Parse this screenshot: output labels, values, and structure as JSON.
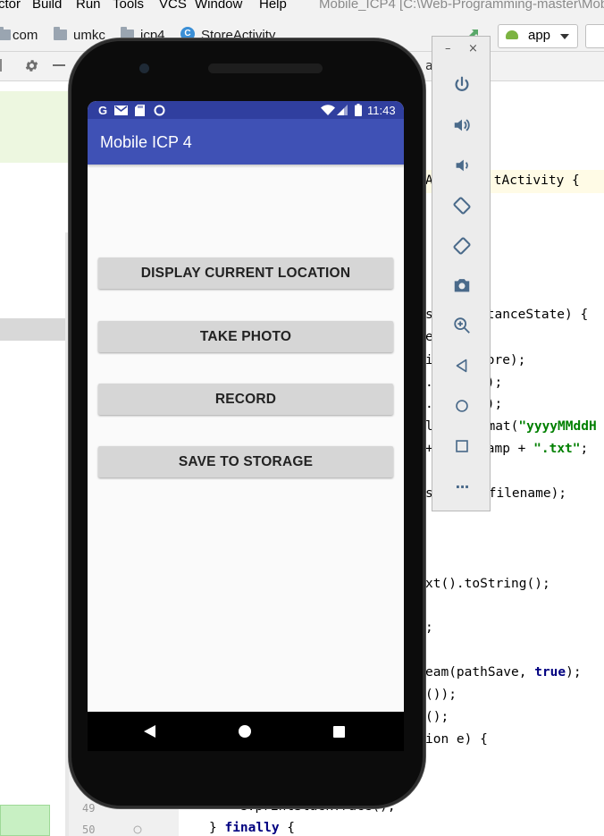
{
  "ide": {
    "menu": [
      "ctor",
      "Build",
      "Run",
      "Tools",
      "VCS",
      "Window",
      "Help"
    ],
    "window_title": "Mobile_ICP4 [C:\\Web-Programming-master\\Mob",
    "breadcrumbs": [
      "com",
      "umkc",
      "icp4",
      "StoreActivity"
    ],
    "class_icon_letter": "C",
    "run_config": "app",
    "tab_fragment": "a",
    "line_numbers": [
      "49",
      "50"
    ],
    "code_lines": {
      "l1": "AppCompatActivity {",
      "l1a": "A",
      "l1b": "tActivity {",
      "l2a": "s",
      "l2b": "tanceState) {",
      "l3": "e",
      "l4a": "i",
      "l4b": "ore);",
      "l5a": ".",
      "l5b": ");",
      "l6a": ".",
      "l6b": ");",
      "l7a": "l",
      "l7b": "rmat(",
      "l7c": "\"yyyyMMddH",
      "l8a": "+",
      "l8b": "amp + ",
      "l8c": "\".txt\"",
      "l8d": ";",
      "l9a": "s",
      "l9b": "filename);",
      "l10": "xt().toString();",
      "l11": ";",
      "l12a": "eam(pathSave, ",
      "l12b": "true",
      "l12c": ");",
      "l13": "());",
      "l14": "();",
      "l15": "ion e) {",
      "l16": "e.printStackTrace();",
      "l17a": "} ",
      "l17b": "finally",
      "l17c": " {"
    }
  },
  "emulator": {
    "minimize": "–",
    "close": "×",
    "buttons": [
      "power-icon",
      "volume-up-icon",
      "volume-down-icon",
      "rotate-left-icon",
      "rotate-right-icon",
      "camera-icon",
      "zoom-icon",
      "back-icon",
      "home-icon",
      "overview-icon",
      "more-icon"
    ],
    "more_label": "···"
  },
  "phone": {
    "status_time": "11:43",
    "status_icons": [
      "google-icon",
      "gmail-icon",
      "sd-card-icon",
      "sync-icon",
      "wifi-icon",
      "signal-icon",
      "battery-icon"
    ],
    "app_title": "Mobile ICP 4",
    "buttons": [
      "DISPLAY CURRENT LOCATION",
      "TAKE PHOTO",
      "RECORD",
      "SAVE TO STORAGE"
    ],
    "colors": {
      "status_bar": "#303f9f",
      "app_bar": "#3f51b5",
      "button": "#d6d6d6"
    }
  }
}
